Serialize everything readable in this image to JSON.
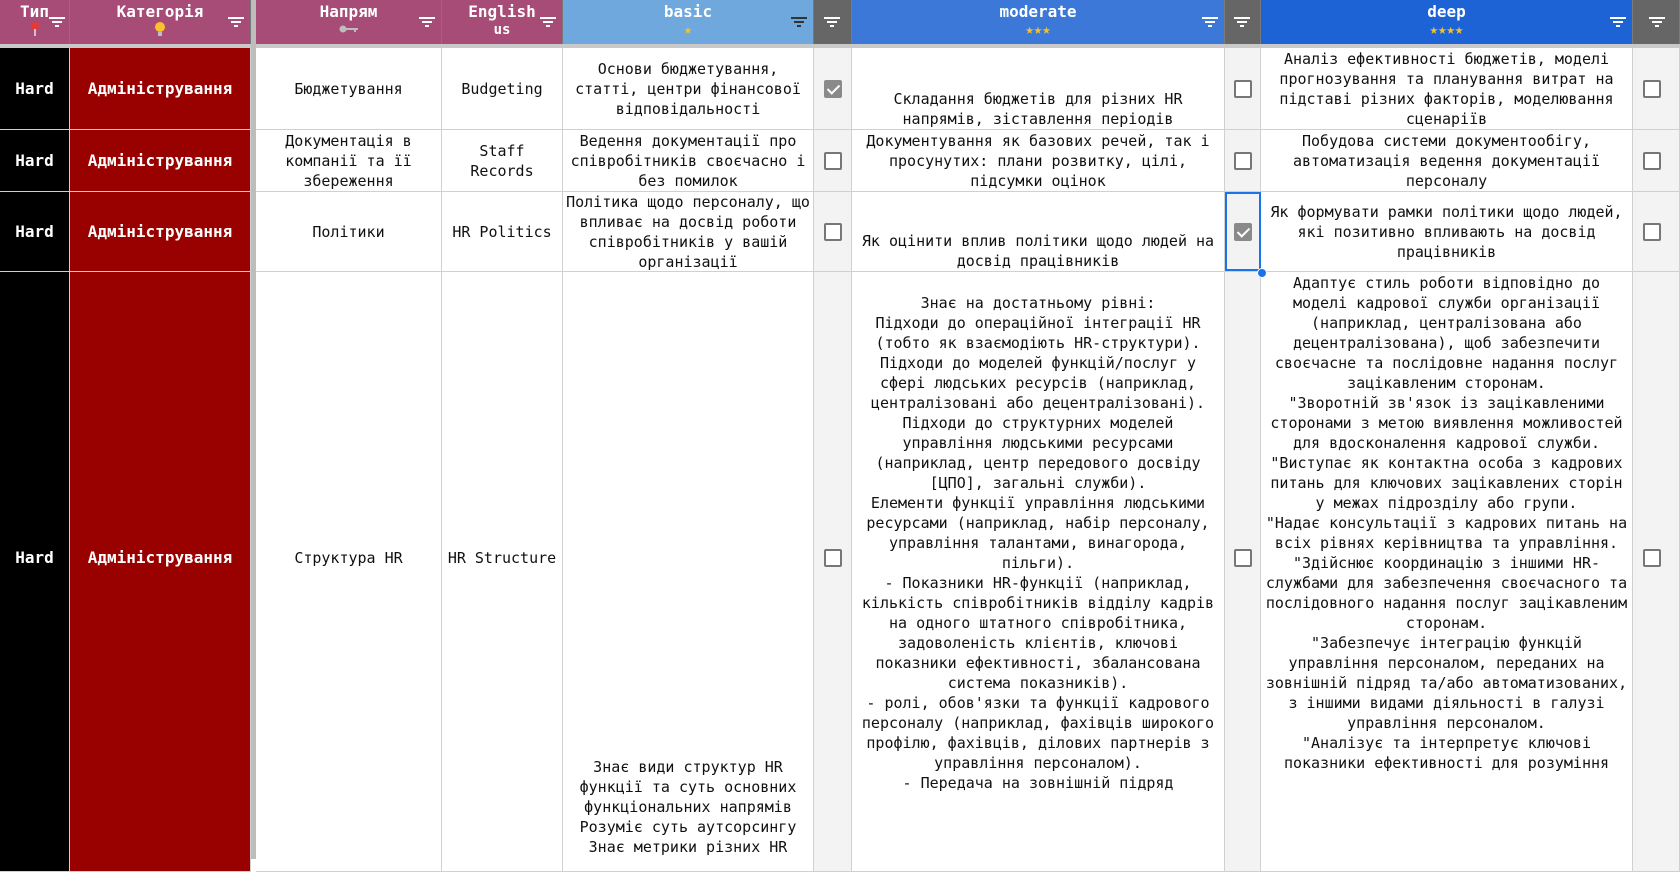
{
  "headers": {
    "type": {
      "title": "Тип"
    },
    "category": {
      "title": "Категорія"
    },
    "direction": {
      "title": "Напрям"
    },
    "english": {
      "title": "English",
      "sub": "us"
    },
    "basic": {
      "title": "basic",
      "stars": "★"
    },
    "moderate": {
      "title": "moderate",
      "stars": "★★★"
    },
    "deep": {
      "title": "deep",
      "stars": "★★★★"
    }
  },
  "icons": {
    "type": "pin-icon",
    "category": "lightbulb-icon",
    "direction": "key-icon",
    "filter": "filter-icon"
  },
  "colors": {
    "header_pink": "#a64c76",
    "header_basic": "#6fa8dc",
    "header_moderate": "#3c78d8",
    "header_deep": "#1e63d6",
    "type_bg": "#000000",
    "category_bg": "#990000",
    "selection": "#1a73e8"
  },
  "rows": [
    {
      "type": "Hard",
      "category": "Адміністрування",
      "direction": "Бюджетування",
      "english": "Budgeting",
      "basic": "Основи бюджетування, статті, центри фінансової відповідальності",
      "basic_checked": true,
      "moderate": "Складання бюджетів для різних HR напрямів, зіставлення періодів",
      "moderate_checked": false,
      "deep": "Аналіз ефективності бюджетів, моделі прогнозування та планування витрат на підставі різних факторів, моделювання сценаріїв",
      "deep_checked": false
    },
    {
      "type": "Hard",
      "category": "Адміністрування",
      "direction": "Документація в компанії та її збереження",
      "english": "Staff Records",
      "basic": "Ведення документації про співробітників своєчасно і без помилок",
      "basic_checked": false,
      "moderate": "Документування як базових речей, так і просунутих: плани розвитку, цілі, підсумки оцінок",
      "moderate_checked": false,
      "deep": "Побудова системи документообігу, автоматизація ведення документації персоналу",
      "deep_checked": false
    },
    {
      "type": "Hard",
      "category": "Адміністрування",
      "direction": "Політики",
      "english": "HR Politics",
      "basic": "Політика щодо персоналу, що впливає на досвід роботи співробітників у вашій організації",
      "basic_checked": false,
      "moderate": "Як оцінити вплив політики щодо людей на досвід працівників",
      "moderate_checked": true,
      "deep": "Як формувати рамки політики щодо людей, які позитивно впливають на досвід працівників",
      "deep_checked": false
    },
    {
      "type": "Hard",
      "category": "Адміністрування",
      "direction": "Структура HR",
      "english": "HR Structure",
      "basic": "Знає види структур HR функції та суть основних функціональних напрямів\nРозуміє суть аутсорсингу\nЗнає метрики різних HR",
      "basic_checked": false,
      "moderate": "Знає на достатньому рівні:\nПідходи до операційної інтеграції HR (тобто як взаємодіють HR-структури).\nПідходи до моделей функцій/послуг у сфері людських ресурсів (наприклад, централізовані або децентралізовані).\nПідходи до структурних моделей управління людськими ресурсами (наприклад, центр передового досвіду [ЦПО], загальні служби).\nЕлементи функції управління людськими ресурсами (наприклад, набір персоналу, управління талантами, винагорода, пільги).\n- Показники HR-функції (наприклад, кількість співробітників відділу кадрів на одного штатного співробітника, задоволеність клієнтів, ключові показники ефективності, збалансована система показників).\n- ролі, обов'язки та функції кадрового персоналу (наприклад, фахівців широкого профілю, фахівців, ділових партнерів з управління персоналом).\n- Передача на зовнішній підряд",
      "moderate_checked": false,
      "deep": "Адаптує стиль роботи відповідно до моделі кадрової служби організації (наприклад, централізована або децентралізована), щоб забезпечити своєчасне та послідовне надання послуг зацікавленим сторонам.\n\"Зворотній зв'язок із зацікавленими сторонами з метою виявлення можливостей для вдосконалення кадрової служби.\n\"Виступає як контактна особа з кадрових питань для ключових зацікавлених сторін у межах підрозділу або групи.\n\"Надає консультації з кадрових питань на всіх рівнях керівництва та управління.\n\"Здійснює координацію з іншими HR-службами для забезпечення своєчасного та послідовного надання послуг зацікавленим сторонам.\n\"Забезпечує інтеграцію функцій управління персоналом, переданих на зовнішній підряд та/або автоматизованих, з іншими видами діяльності в галузі управління персоналом.\n\"Аналізує та інтерпретує ключові показники ефективності для розуміння",
      "deep_checked": false
    }
  ]
}
